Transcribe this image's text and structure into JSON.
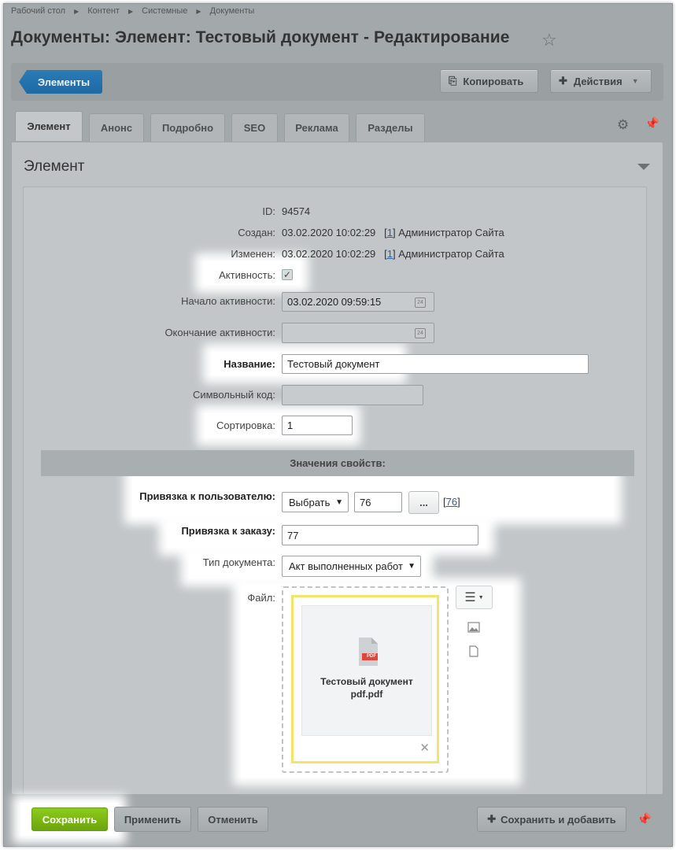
{
  "breadcrumbs": [
    "Рабочий стол",
    "Контент",
    "Системные",
    "Документы"
  ],
  "page_title": "Документы: Элемент: Тестовый документ - Редактирование",
  "toolbar": {
    "elements_label": "Элементы",
    "copy_label": "Копировать",
    "actions_label": "Действия"
  },
  "tabs": [
    "Элемент",
    "Анонс",
    "Подробно",
    "SEO",
    "Реклама",
    "Разделы"
  ],
  "section_title": "Элемент",
  "fields": {
    "id_label": "ID:",
    "id_value": "94574",
    "created_label": "Создан:",
    "created_date": "03.02.2020 10:02:29",
    "created_user_link": "1",
    "created_user_name": "Администратор Сайта",
    "modified_label": "Изменен:",
    "modified_date": "03.02.2020 10:02:29",
    "modified_user_link": "1",
    "modified_user_name": "Администратор Сайта",
    "active_label": "Активность:",
    "active_from_label": "Начало активности:",
    "active_from_value": "03.02.2020 09:59:15",
    "active_to_label": "Окончание активности:",
    "active_to_value": "",
    "name_label": "Название:",
    "name_value": "Тестовый документ",
    "code_label": "Символьный код:",
    "code_value": "",
    "sort_label": "Сортировка:",
    "sort_value": "1"
  },
  "properties": {
    "header": "Значения свойств:",
    "user_link_label": "Привязка к пользователю:",
    "user_select": "Выбрать",
    "user_id_value": "76",
    "user_dots": "...",
    "user_link_text": "76",
    "order_link_label": "Привязка к заказу:",
    "order_value": "77",
    "doc_type_label": "Тип документа:",
    "doc_type_value": "Акт выполненных работ",
    "file_label": "Файл:",
    "file_name_line1": "Тестовый документ",
    "file_name_line2": "pdf.pdf",
    "file_badge": "PDF"
  },
  "footer": {
    "save_label": "Сохранить",
    "apply_label": "Применить",
    "cancel_label": "Отменить",
    "save_add_label": "Сохранить и добавить"
  }
}
